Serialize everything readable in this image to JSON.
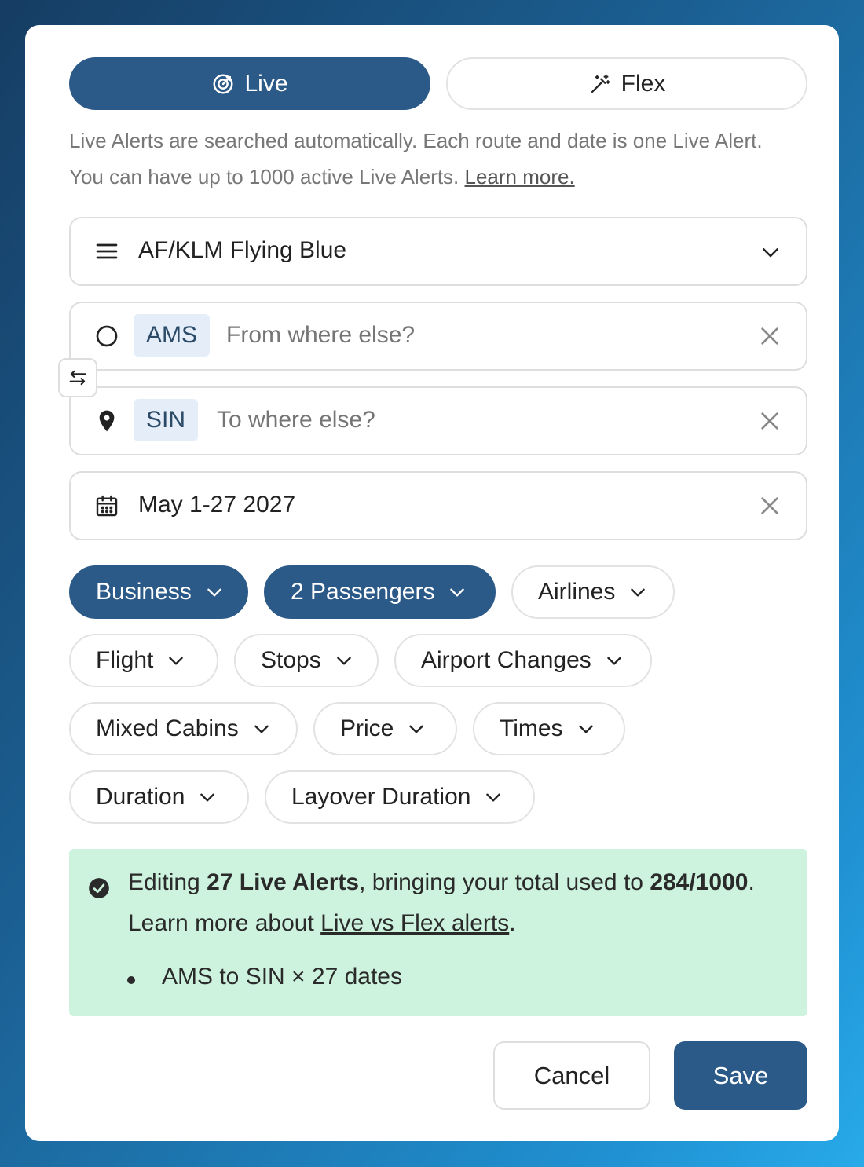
{
  "mode_toggle": {
    "live_label": "Live",
    "flex_label": "Flex",
    "selected": "Live"
  },
  "description": {
    "text": "Live Alerts are searched automatically. Each route and date is one Live Alert. You can have up to 1000 active Live Alerts. ",
    "link": "Learn more."
  },
  "program": {
    "value": "AF/KLM Flying Blue",
    "icon": "menu-icon"
  },
  "origin": {
    "code": "AMS",
    "placeholder": "From where else?"
  },
  "destination": {
    "code": "SIN",
    "placeholder": "To where else?"
  },
  "dates": {
    "value": "May 1-27 2027"
  },
  "filters": [
    {
      "label": "Business",
      "selected": true
    },
    {
      "label": "2 Passengers",
      "selected": true
    },
    {
      "label": "Airlines",
      "selected": false
    },
    {
      "label": "Flight",
      "selected": false
    },
    {
      "label": "Stops",
      "selected": false
    },
    {
      "label": "Airport Changes",
      "selected": false
    },
    {
      "label": "Mixed Cabins",
      "selected": false
    },
    {
      "label": "Price",
      "selected": false
    },
    {
      "label": "Times",
      "selected": false
    },
    {
      "label": "Duration",
      "selected": false
    },
    {
      "label": "Layover Duration",
      "selected": false
    }
  ],
  "info": {
    "prefix": "Editing ",
    "count": "27 Live Alerts",
    "middle": ", bringing your total used to ",
    "usage": "284/1000",
    "suffix": ".",
    "line2_prefix": "Learn more about ",
    "line2_link": "Live vs Flex alerts",
    "line2_suffix": ".",
    "items": [
      "AMS to SIN × 27 dates"
    ]
  },
  "actions": {
    "cancel": "Cancel",
    "save": "Save"
  },
  "colors": {
    "accent": "#2c5a88",
    "info_bg": "#cdf3df",
    "code_chip_bg": "#e5eef8"
  }
}
